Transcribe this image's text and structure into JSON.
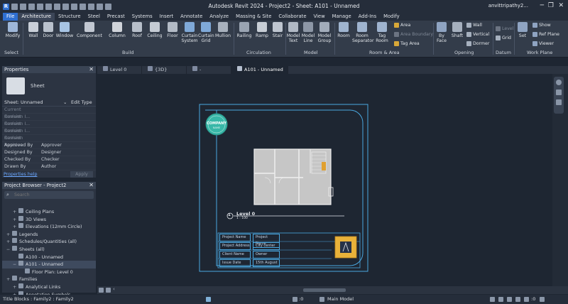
{
  "app": {
    "title": "Autodesk Revit 2024 - Project2 - Sheet: A101 - Unnamed",
    "user": "anvittripathy2...",
    "window_controls": [
      "─",
      "❐",
      "✕"
    ]
  },
  "menu_tabs": [
    "File",
    "Architecture",
    "Structure",
    "Steel",
    "Precast",
    "Systems",
    "Insert",
    "Annotate",
    "Analyze",
    "Massing & Site",
    "Collaborate",
    "View",
    "Manage",
    "Add-Ins",
    "Modify"
  ],
  "ribbon": {
    "buttons": {
      "modify": "Modify",
      "wall": "Wall",
      "door": "Door",
      "window": "Window",
      "component": "Component",
      "column": "Column",
      "roof": "Roof",
      "ceiling": "Ceiling",
      "floor": "Floor",
      "curtain_system": "Curtain System",
      "curtain_grid": "Curtain Grid",
      "mullion": "Mullion",
      "railing": "Railing",
      "ramp": "Ramp",
      "stair": "Stair",
      "model_text": "Model Text",
      "model_line": "Model Line",
      "model_group": "Model Group",
      "room": "Room",
      "room_separator": "Room Separator",
      "tag_room": "Tag Room",
      "area": "Area",
      "area_boundary": "Area Boundary",
      "tag_area": "Tag Area",
      "by_face": "By Face",
      "shaft": "Shaft",
      "opening_wall": "Wall",
      "vertical": "Vertical",
      "dormer": "Dormer",
      "level": "Level",
      "grid": "Grid",
      "set": "Set",
      "show": "Show",
      "ref_plane": "Ref Plane",
      "viewer": "Viewer"
    },
    "groups": {
      "select": "Select",
      "build": "Build",
      "circulation": "Circulation",
      "model": "Model",
      "room_area": "Room & Area",
      "opening": "Opening",
      "datum": "Datum",
      "work_plane": "Work Plane"
    }
  },
  "properties": {
    "title": "Properties",
    "family_type": "Sheet",
    "selector": "Sheet: Unnamed",
    "edit_type": "Edit Type",
    "rows": [
      {
        "k": "Current Revision I...",
        "v": "",
        "dim": true
      },
      {
        "k": "Current Revision I...",
        "v": "",
        "dim": true
      },
      {
        "k": "Current Revision I...",
        "v": "",
        "dim": true
      },
      {
        "k": "Current Revision",
        "v": "",
        "dim": true
      },
      {
        "k": "Current Revision",
        "v": "",
        "dim": true
      },
      {
        "k": "Approved By",
        "v": "Approver",
        "dim": false
      },
      {
        "k": "Designed By",
        "v": "Designer",
        "dim": false
      },
      {
        "k": "Checked By",
        "v": "Checker",
        "dim": false
      },
      {
        "k": "Drawn By",
        "v": "Author",
        "dim": false
      }
    ],
    "help_link": "Properties help",
    "apply": "Apply"
  },
  "project_browser": {
    "title": "Project Browser - Project2",
    "search_placeholder": "Search",
    "items": [
      {
        "sign": "+",
        "label": "Ceiling Plans",
        "indent": 1
      },
      {
        "sign": "+",
        "label": "3D Views",
        "indent": 1
      },
      {
        "sign": "+",
        "label": "Elevations (12mm Circle)",
        "indent": 1
      },
      {
        "sign": "+",
        "label": "Legends",
        "indent": 0
      },
      {
        "sign": "+",
        "label": "Schedules/Quantities (all)",
        "indent": 0
      },
      {
        "sign": "−",
        "label": "Sheets (all)",
        "indent": 0
      },
      {
        "sign": "",
        "label": "A100 - Unnamed",
        "indent": 1
      },
      {
        "sign": "−",
        "label": "A101 - Unnamed",
        "indent": 1,
        "selected": true
      },
      {
        "sign": "",
        "label": "Floor Plan: Level 0",
        "indent": 2
      },
      {
        "sign": "+",
        "label": "Families",
        "indent": 0
      },
      {
        "sign": "+",
        "label": "Analytical Links",
        "indent": 1
      },
      {
        "sign": "+",
        "label": "Annotation Symbols",
        "indent": 1
      }
    ]
  },
  "view_tabs": [
    "Level 0",
    "{3D}",
    "-",
    "A101 - Unnamed"
  ],
  "sheet": {
    "logo_line1": "COMPANY",
    "logo_line2": "NAME",
    "view_number": "1",
    "view_name": "Level 0",
    "view_scale": "1 : 100",
    "title_block": [
      {
        "label": "Project Name",
        "value": "Project Name"
      },
      {
        "label": "Project Address",
        "value": "City center"
      },
      {
        "label": "Client Name",
        "value": "Owner"
      },
      {
        "label": "Issue Date",
        "value": "15th August"
      }
    ]
  },
  "status": {
    "left_text": "Title Blocks : Family2 : Family2",
    "workset": ":0",
    "main_model": "Main Model",
    "count": ":0"
  },
  "colors": {
    "accent": "#2f6fd0",
    "sheet_border": "#4aa8e0",
    "logo": "#38b7a8"
  }
}
